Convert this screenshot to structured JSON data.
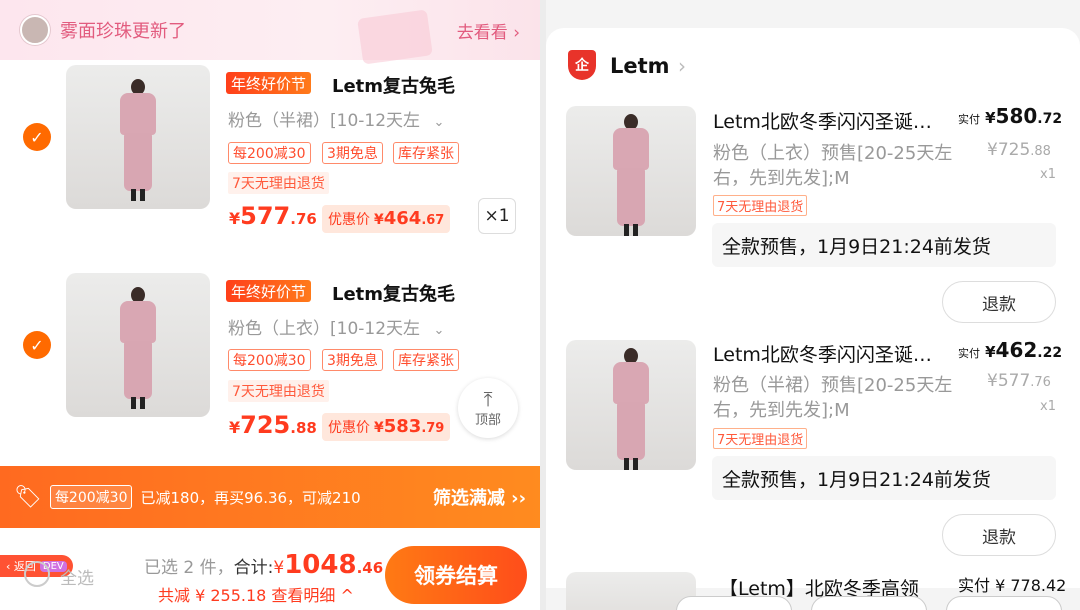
{
  "cart": {
    "notice": {
      "text": "雾面珍珠更新了",
      "action": "去看看 ›"
    },
    "items": [
      {
        "badge": "年终好价节",
        "title": "Letm复古兔毛",
        "sku": "粉色（半裙）[10-12天左",
        "chips": [
          "每200减30",
          "3期免息",
          "库存紧张"
        ],
        "return_policy": "7天无理由退货",
        "price": {
          "yen": "¥",
          "int": "577",
          "dec": ".76"
        },
        "discount": {
          "label": "优惠价",
          "yen": "¥",
          "int": "464",
          "dec": ".67"
        },
        "qty": "×1"
      },
      {
        "badge": "年终好价节",
        "title": "Letm复古兔毛",
        "sku": "粉色（上衣）[10-12天左",
        "chips": [
          "每200减30",
          "3期免息",
          "库存紧张"
        ],
        "return_policy": "7天无理由退货",
        "price": {
          "yen": "¥",
          "int": "725",
          "dec": ".88"
        },
        "discount": {
          "label": "优惠价",
          "yen": "¥",
          "int": "583",
          "dec": ".79"
        }
      }
    ],
    "top_button": {
      "label": "顶部"
    },
    "promo": {
      "chip": "每200减30",
      "text": "已减180，再买96.36，可减210",
      "action": "筛选满减 ››"
    },
    "back_button": {
      "label": "‹ 返回",
      "badge": "DEV"
    },
    "select_all": "全选",
    "summary": {
      "selected": "已选 2 件，",
      "total_label": "合计:",
      "yen": "¥",
      "int": "1048",
      "dec": ".46"
    },
    "savings": "共减 ¥ 255.18  查看明细 ^",
    "checkout_button": "领券结算"
  },
  "order": {
    "shop": {
      "icon": "企",
      "name": "Letm",
      "arrow": "›"
    },
    "items": [
      {
        "title": "Letm北欧冬季闪闪圣诞…",
        "paid": {
          "label": "实付",
          "yen": "¥",
          "int": "580",
          "dec": ".72"
        },
        "sku": "粉色（上衣）预售[20-25天左右，先到先发];M",
        "orig": {
          "yen": "¥",
          "int": "725",
          "dec": ".88"
        },
        "qty": "x1",
        "return_policy": "7天无理由退货",
        "ship": "全款预售，1月9日21:24前发货",
        "refund": "退款"
      },
      {
        "title": "Letm北欧冬季闪闪圣诞…",
        "paid": {
          "label": "实付",
          "yen": "¥",
          "int": "462",
          "dec": ".22"
        },
        "sku": "粉色（半裙）预售[20-25天左右，先到先发];M",
        "orig": {
          "yen": "¥",
          "int": "577",
          "dec": ".76"
        },
        "qty": "x1",
        "return_policy": "7天无理由退货",
        "ship": "全款预售，1月9日21:24前发货",
        "refund": "退款"
      }
    ],
    "cut_item": {
      "title": "【Letm】北欧冬季高领",
      "paid": "实付 ¥ 778.42"
    }
  },
  "colors": {
    "accent": "#ff6a00",
    "price": "#ff3b1f",
    "pink": "#e25b7e"
  },
  "icons": {
    "check": "check-icon",
    "ticket": "ticket-icon",
    "arrow_up": "arrow-up-icon",
    "shop": "shop-badge-icon"
  }
}
